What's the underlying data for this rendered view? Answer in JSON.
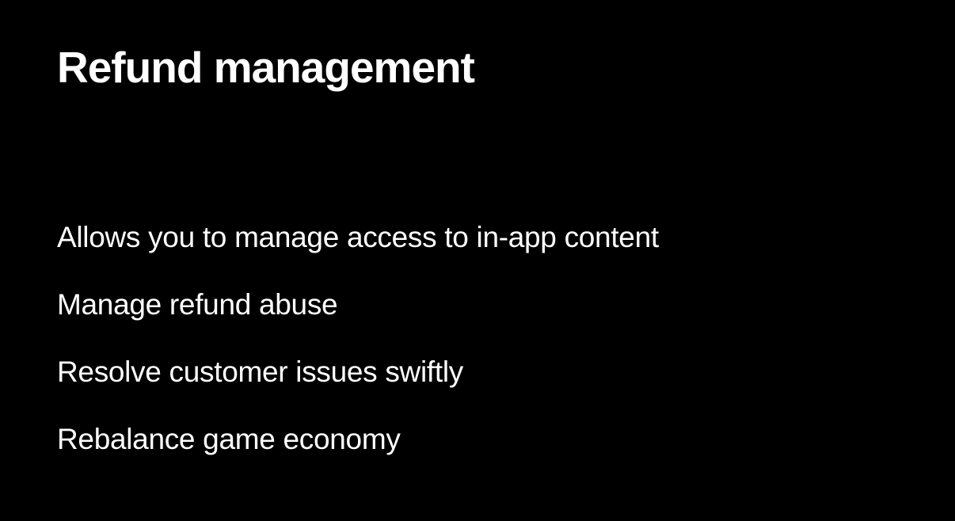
{
  "slide": {
    "title": "Refund management",
    "bullets": [
      "Allows you to manage access to in-app content",
      "Manage refund abuse",
      "Resolve customer issues swiftly",
      "Rebalance game economy"
    ]
  },
  "colors": {
    "background": "#000000",
    "text": "#ffffff"
  }
}
